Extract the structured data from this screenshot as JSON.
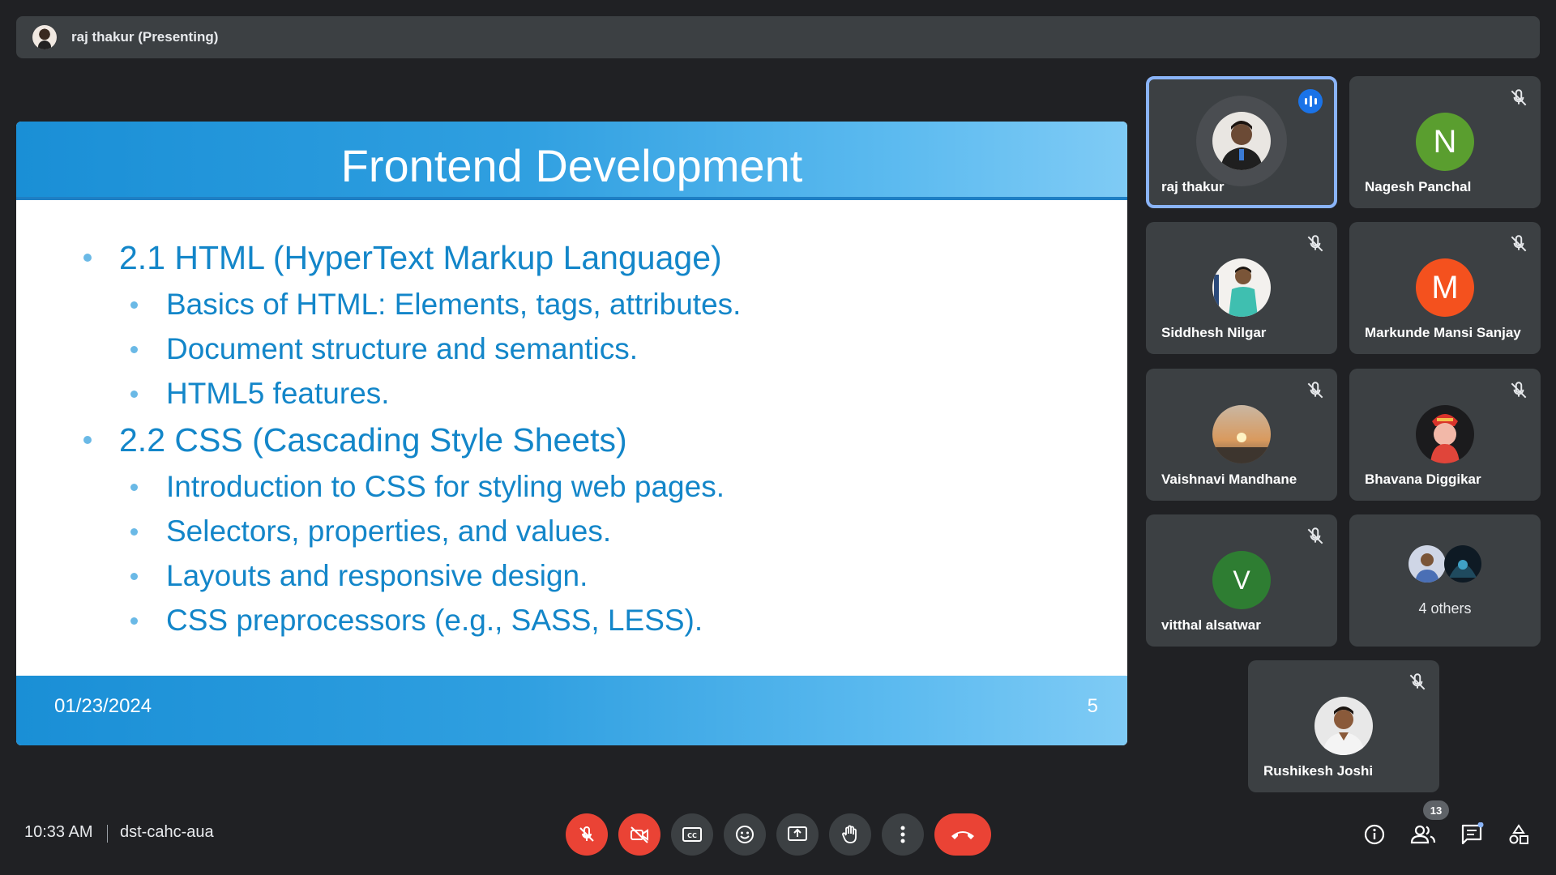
{
  "presenter_bar": {
    "label": "raj thakur (Presenting)"
  },
  "slide": {
    "title": "Frontend Development",
    "bullets": [
      {
        "text": "2.1 HTML (HyperText Markup Language)",
        "sub": [
          "Basics of HTML: Elements, tags, attributes.",
          "Document structure and semantics.",
          "HTML5 features."
        ]
      },
      {
        "text": "2.2 CSS (Cascading Style Sheets)",
        "sub": [
          "Introduction to CSS for styling web pages.",
          "Selectors, properties, and values.",
          "Layouts and responsive design.",
          "CSS preprocessors (e.g., SASS, LESS)."
        ]
      }
    ],
    "date": "01/23/2024",
    "page_number": "5",
    "colors": {
      "header": "#1a8fd6",
      "text": "#1386c9"
    }
  },
  "participants": [
    {
      "name": "raj thakur",
      "avatar": "photo",
      "speaking": true,
      "muted": false
    },
    {
      "name": "Nagesh Panchal",
      "avatar": "letter",
      "letter": "N",
      "color": "#5a9e2f",
      "muted": true
    },
    {
      "name": "Siddhesh Nilgar",
      "avatar": "photo",
      "muted": true
    },
    {
      "name": "Markunde Mansi Sanjay",
      "avatar": "letter",
      "letter": "M",
      "color": "#f4511e",
      "muted": true
    },
    {
      "name": "Vaishnavi Mandhane",
      "avatar": "photo",
      "muted": true
    },
    {
      "name": "Bhavana Diggikar",
      "avatar": "photo",
      "muted": true
    },
    {
      "name": "vitthal alsatwar",
      "avatar": "letter",
      "letter": "V",
      "color": "#2e7d32",
      "muted": true
    },
    {
      "name": "4 others",
      "avatar": "group"
    },
    {
      "name": "Rushikesh Joshi",
      "avatar": "photo",
      "muted": true
    }
  ],
  "bottom_bar": {
    "time": "10:33 AM",
    "meeting_code": "dst-cahc-aua",
    "controls": [
      "mic-off-icon",
      "camera-off-icon",
      "captions-icon",
      "emoji-icon",
      "present-icon",
      "raise-hand-icon",
      "more-options-icon",
      "end-call-icon"
    ],
    "right_icons": [
      "info-icon",
      "people-icon",
      "chat-icon",
      "activities-icon"
    ],
    "people_count": "13"
  }
}
